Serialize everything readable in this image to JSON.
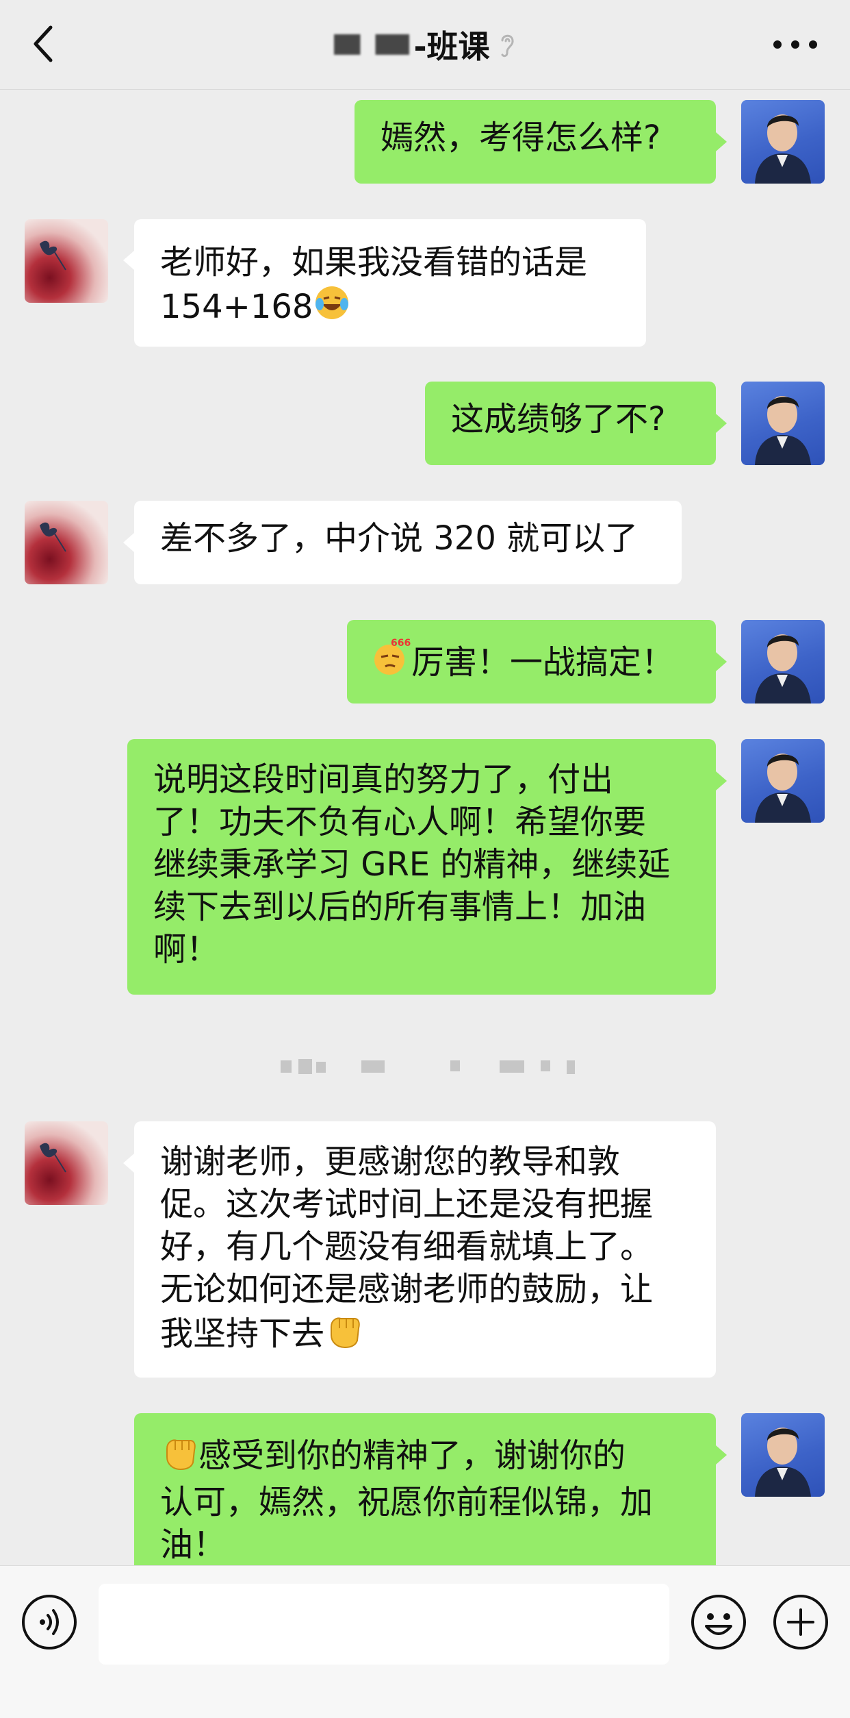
{
  "header": {
    "title": "-班课",
    "back_icon": "chevron-left-icon",
    "ear_icon": "ear-icon",
    "more_icon": "more-dots-icon"
  },
  "messages": [
    {
      "from": "me",
      "text": "嫣然，考得怎么样?"
    },
    {
      "from": "them",
      "lines": [
        "老师好，如果我没看错的话是",
        "154+168"
      ],
      "emoji": "laughing-crying-emoji"
    },
    {
      "from": "me",
      "text": "这成绩够了不?"
    },
    {
      "from": "them",
      "text": "差不多了，中介说 320 就可以了"
    },
    {
      "from": "me",
      "text": "厉害！一战搞定！",
      "emoji": "666-emoji"
    },
    {
      "from": "me",
      "lines": [
        "说明这段时间真的努力了，付出",
        "了！功夫不负有心人啊！希望你要",
        "继续秉承学习 GRE 的精神，继续延",
        "续下去到以后的所有事情上！加油",
        "啊！"
      ]
    },
    {
      "from": "them",
      "lines": [
        "谢谢老师，更感谢您的教导和敦",
        "促。这次考试时间上还是没有把握",
        "好，有几个题没有细看就填上了。",
        "无论如何还是感谢老师的鼓励，让",
        "我坚持下去"
      ],
      "emoji": "fist-emoji"
    },
    {
      "from": "me",
      "lines": [
        "感受到你的精神了，谢谢你的",
        "认可，嫣然，祝愿你前程似锦，加",
        "油！"
      ],
      "emoji": "fist-emoji"
    }
  ],
  "input_bar": {
    "voice_icon": "voice-icon",
    "emoji_icon": "smiley-icon",
    "plus_icon": "plus-icon"
  },
  "colors": {
    "background": "#ededed",
    "my_bubble": "#95ec69",
    "their_bubble": "#ffffff"
  }
}
